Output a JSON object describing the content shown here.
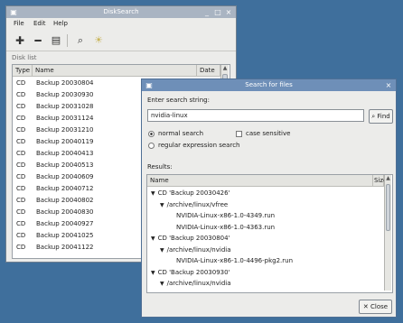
{
  "diskwin": {
    "title": "DiskSearch",
    "menus": [
      "File",
      "Edit",
      "Help"
    ],
    "disk_list_label": "Disk list",
    "columns": {
      "type": "Type",
      "name": "Name",
      "date": "Date"
    },
    "rows": [
      {
        "type": "CD",
        "name": "Backup 20030804"
      },
      {
        "type": "CD",
        "name": "Backup 20030930"
      },
      {
        "type": "CD",
        "name": "Backup 20031028"
      },
      {
        "type": "CD",
        "name": "Backup 20031124"
      },
      {
        "type": "CD",
        "name": "Backup 20031210"
      },
      {
        "type": "CD",
        "name": "Backup 20040119"
      },
      {
        "type": "CD",
        "name": "Backup 20040413"
      },
      {
        "type": "CD",
        "name": "Backup 20040513"
      },
      {
        "type": "CD",
        "name": "Backup 20040609"
      },
      {
        "type": "CD",
        "name": "Backup 20040712"
      },
      {
        "type": "CD",
        "name": "Backup 20040802"
      },
      {
        "type": "CD",
        "name": "Backup 20040830"
      },
      {
        "type": "CD",
        "name": "Backup 20040927"
      },
      {
        "type": "CD",
        "name": "Backup 20041025"
      },
      {
        "type": "CD",
        "name": "Backup 20041122"
      }
    ]
  },
  "searchwin": {
    "title": "Search for files",
    "prompt": "Enter search string:",
    "query": "nvidia-linux",
    "find_label": "Find",
    "normal_search": "normal search",
    "case_sensitive": "case sensitive",
    "regex_search": "regular expression search",
    "results_label": "Results:",
    "col_name": "Name",
    "col_size": "Size",
    "tree": [
      {
        "text": "CD 'Backup 20030426'",
        "arrow": "▼"
      },
      {
        "text": "/archive/linux/vfree",
        "arrow": "▼"
      },
      {
        "text": "NVIDIA-Linux-x86-1.0-4349.run",
        "arrow": ""
      },
      {
        "text": "NVIDIA-Linux-x86-1.0-4363.run",
        "arrow": ""
      },
      {
        "text": "CD 'Backup 20030804'",
        "arrow": "▼"
      },
      {
        "text": "/archive/linux/nvidia",
        "arrow": "▼"
      },
      {
        "text": "NVIDIA-Linux-x86-1.0-4496-pkg2.run",
        "arrow": ""
      },
      {
        "text": "CD 'Backup 20030930'",
        "arrow": "▼"
      },
      {
        "text": "/archive/linux/nvidia",
        "arrow": "▼"
      }
    ],
    "close_label": "Close"
  },
  "colors": {
    "desktop": "#3f6f9c",
    "titlebar_active": "#6e8fb8",
    "titlebar_inactive": "#a9b4c2"
  }
}
